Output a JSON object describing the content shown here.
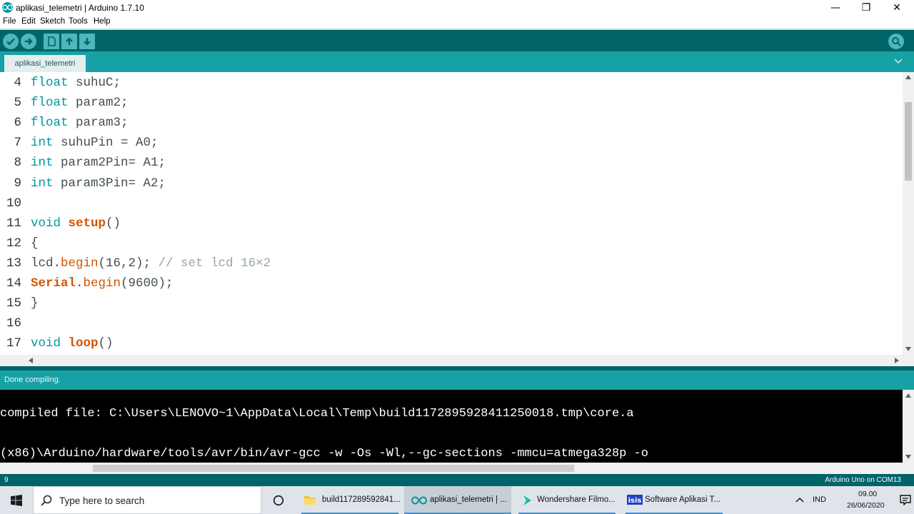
{
  "window": {
    "title": "aplikasi_telemetri | Arduino 1.7.10",
    "minimize": "—",
    "restore": "❐",
    "close": "✕"
  },
  "menu": [
    "File",
    "Edit",
    "Sketch",
    "Tools",
    "Help"
  ],
  "toolbar": {
    "icons": [
      "verify-icon",
      "upload-icon",
      "new-icon",
      "open-icon",
      "save-icon",
      "serial-monitor-icon"
    ],
    "colors": {
      "bar": "#006468",
      "button": "#4db7bb"
    }
  },
  "tab": {
    "label": "aplikasi_telemetri"
  },
  "editor": {
    "lines": [
      {
        "num": "4",
        "segments": [
          {
            "t": "float",
            "c": "kw-type"
          },
          {
            "t": " suhuC;",
            "c": ""
          }
        ]
      },
      {
        "num": "5",
        "segments": [
          {
            "t": "float",
            "c": "kw-type"
          },
          {
            "t": " param2;",
            "c": ""
          }
        ]
      },
      {
        "num": "6",
        "segments": [
          {
            "t": "float",
            "c": "kw-type"
          },
          {
            "t": " param3;",
            "c": ""
          }
        ]
      },
      {
        "num": "7",
        "segments": [
          {
            "t": "int",
            "c": "kw-type"
          },
          {
            "t": " suhuPin = A0;",
            "c": ""
          }
        ]
      },
      {
        "num": "8",
        "segments": [
          {
            "t": "int",
            "c": "kw-type"
          },
          {
            "t": " param2Pin= A1;",
            "c": ""
          }
        ]
      },
      {
        "num": "9",
        "segments": [
          {
            "t": "int",
            "c": "kw-type"
          },
          {
            "t": " param3Pin= A2;",
            "c": ""
          }
        ]
      },
      {
        "num": "10",
        "segments": []
      },
      {
        "num": "11",
        "segments": [
          {
            "t": "void",
            "c": "kw-type"
          },
          {
            "t": " ",
            "c": ""
          },
          {
            "t": "setup",
            "c": "kw-fn"
          },
          {
            "t": "()",
            "c": ""
          }
        ]
      },
      {
        "num": "12",
        "segments": [
          {
            "t": "{",
            "c": ""
          }
        ]
      },
      {
        "num": "13",
        "segments": [
          {
            "t": "lcd.",
            "c": ""
          },
          {
            "t": "begin",
            "c": "kw-meth"
          },
          {
            "t": "(16,2); ",
            "c": ""
          },
          {
            "t": "// set lcd 16×2",
            "c": "comment"
          }
        ]
      },
      {
        "num": "14",
        "segments": [
          {
            "t": "Serial",
            "c": "kw-class"
          },
          {
            "t": ".",
            "c": ""
          },
          {
            "t": "begin",
            "c": "kw-meth"
          },
          {
            "t": "(9600);",
            "c": ""
          }
        ]
      },
      {
        "num": "15",
        "segments": [
          {
            "t": "}",
            "c": ""
          }
        ]
      },
      {
        "num": "16",
        "segments": []
      },
      {
        "num": "17",
        "segments": [
          {
            "t": "void",
            "c": "kw-type"
          },
          {
            "t": " ",
            "c": ""
          },
          {
            "t": "loop",
            "c": "kw-fn"
          },
          {
            "t": "()",
            "c": ""
          }
        ]
      }
    ]
  },
  "status": {
    "message": "Done compiling."
  },
  "console": {
    "lines": [
      "compiled file: C:\\Users\\LENOVO~1\\AppData\\Local\\Temp\\build1172895928411250018.tmp\\core.a",
      "(x86)\\Arduino/hardware/tools/avr/bin/avr-gcc -w -Os -Wl,--gc-sections -mmcu=atmega328p -o"
    ]
  },
  "footer": {
    "line_number": "9",
    "board": "Arduino Uno on COM13"
  },
  "taskbar": {
    "search_placeholder": "Type here to search",
    "tasks": [
      {
        "label": "build117289592841...",
        "icon": "folder-icon"
      },
      {
        "label": "aplikasi_telemetri | ...",
        "icon": "arduino-icon",
        "active": true
      },
      {
        "label": "Wondershare Filmo...",
        "icon": "filmora-icon"
      },
      {
        "label": "Software Aplikasi T...",
        "icon": "isis-icon"
      }
    ],
    "tray": {
      "language": "IND",
      "time": "09.00",
      "date": "26/06/2020"
    }
  }
}
